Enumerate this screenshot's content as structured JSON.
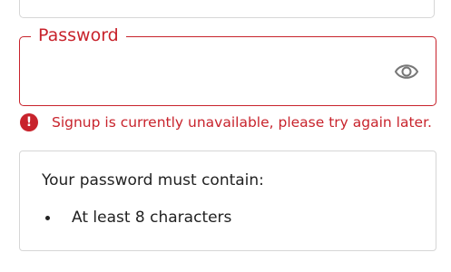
{
  "password_field": {
    "label": "Password",
    "value": "",
    "visibility_icon": "eye-icon"
  },
  "error": {
    "icon": "exclamation-icon",
    "message": "Signup is currently unavailable, please try again later."
  },
  "requirements": {
    "title": "Your password must contain:",
    "items": [
      "At least 8 characters"
    ]
  },
  "colors": {
    "error": "#c8232c",
    "border": "#d6d6d6",
    "text": "#222222"
  }
}
